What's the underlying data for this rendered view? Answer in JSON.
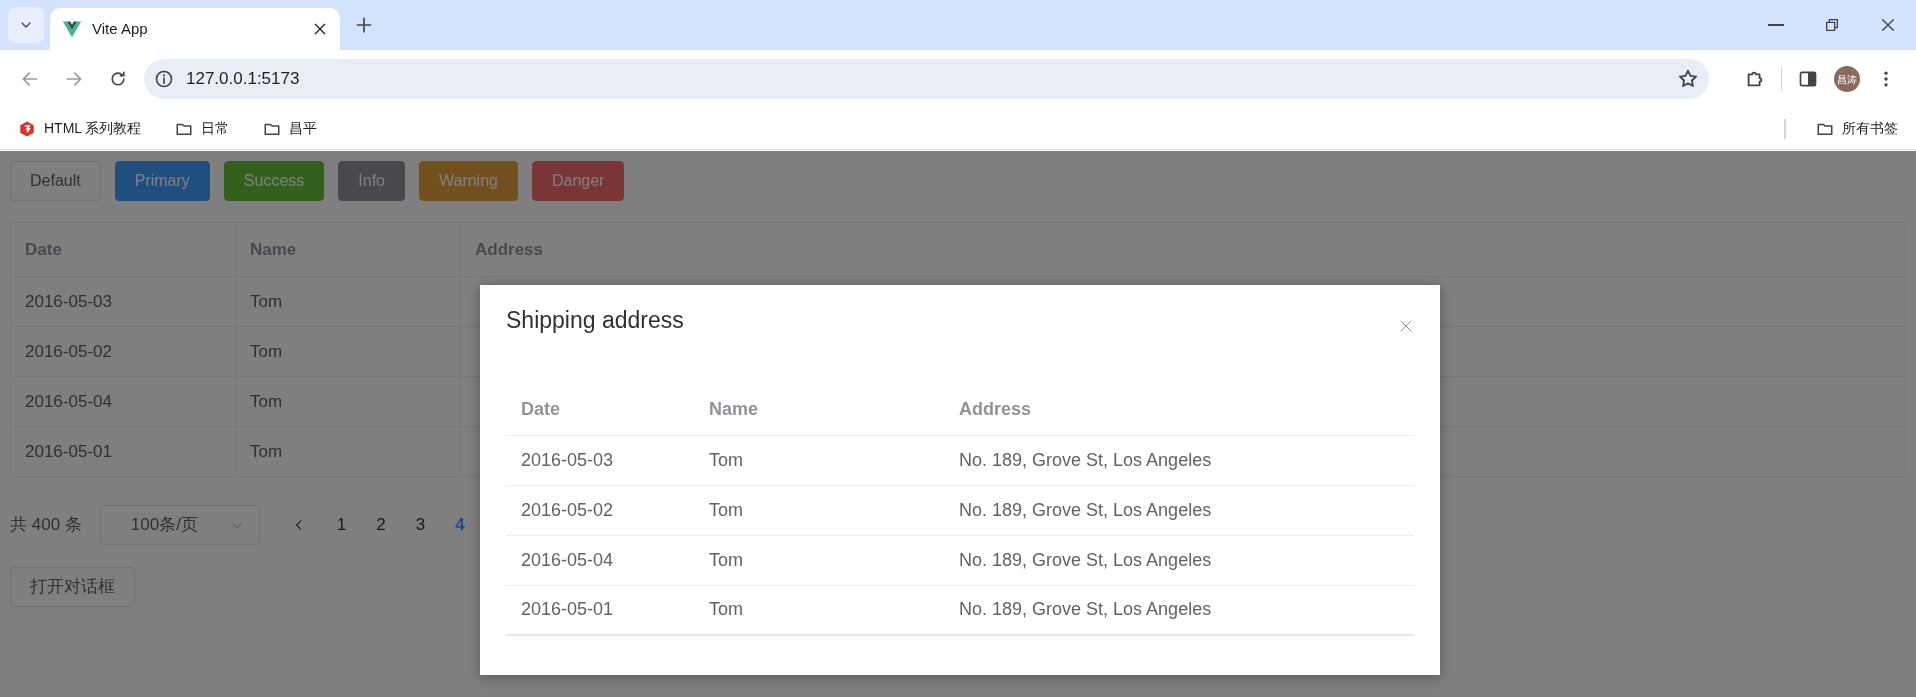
{
  "browser": {
    "tabs": [
      {
        "title": "Vite App",
        "selected": true
      }
    ],
    "address": "127.0.0.1:5173",
    "avatar": "昌涛",
    "bookmarks": [
      {
        "label": "HTML 系列教程",
        "kind": "site"
      },
      {
        "label": "日常",
        "kind": "folder"
      },
      {
        "label": "昌平",
        "kind": "folder"
      }
    ],
    "all_bookmarks": "所有书签"
  },
  "page": {
    "buttons": [
      {
        "label": "Default",
        "kind": "default"
      },
      {
        "label": "Primary",
        "kind": "primary"
      },
      {
        "label": "Success",
        "kind": "success"
      },
      {
        "label": "Info",
        "kind": "info"
      },
      {
        "label": "Warning",
        "kind": "warning"
      },
      {
        "label": "Danger",
        "kind": "danger"
      }
    ],
    "table": {
      "columns": [
        "Date",
        "Name",
        "Address"
      ],
      "rows": [
        {
          "date": "2016-05-03",
          "name": "Tom"
        },
        {
          "date": "2016-05-02",
          "name": "Tom"
        },
        {
          "date": "2016-05-04",
          "name": "Tom"
        },
        {
          "date": "2016-05-01",
          "name": "Tom"
        }
      ]
    },
    "pagination": {
      "total": "共 400 条",
      "page_size": "100条/页",
      "pages": [
        {
          "label": "1",
          "selected": false
        },
        {
          "label": "2",
          "selected": false
        },
        {
          "label": "3",
          "selected": false
        },
        {
          "label": "4",
          "selected": true
        }
      ]
    },
    "open_dialog_button": "打开对话框"
  },
  "dialog": {
    "title": "Shipping address",
    "columns": [
      "Date",
      "Name",
      "Address"
    ],
    "rows": [
      {
        "date": "2016-05-03",
        "name": "Tom",
        "address": "No. 189, Grove St, Los Angeles"
      },
      {
        "date": "2016-05-02",
        "name": "Tom",
        "address": "No. 189, Grove St, Los Angeles"
      },
      {
        "date": "2016-05-04",
        "name": "Tom",
        "address": "No. 189, Grove St, Los Angeles"
      },
      {
        "date": "2016-05-01",
        "name": "Tom",
        "address": "No. 189, Grove St, Los Angeles"
      }
    ]
  }
}
